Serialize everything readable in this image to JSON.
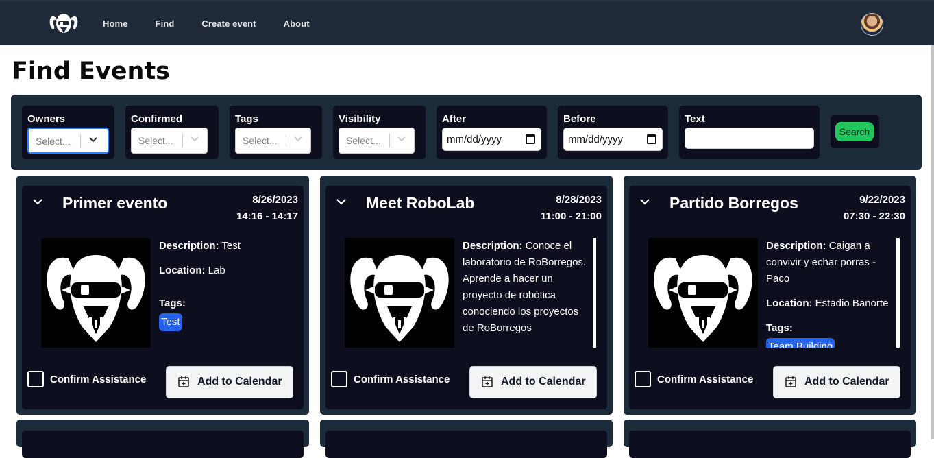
{
  "nav": {
    "logo_icon": "borrego-ram-logo-icon",
    "links": [
      "Home",
      "Find",
      "Create event",
      "About"
    ],
    "avatar_icon": "user-avatar"
  },
  "page": {
    "title": "Find Events"
  },
  "filters": {
    "owners": {
      "label": "Owners",
      "placeholder": "Select..."
    },
    "confirmed": {
      "label": "Confirmed",
      "placeholder": "Select..."
    },
    "tags": {
      "label": "Tags",
      "placeholder": "Select..."
    },
    "visibility": {
      "label": "Visibility",
      "placeholder": "Select..."
    },
    "after": {
      "label": "After",
      "value": "mm/dd/yyyy"
    },
    "before": {
      "label": "Before",
      "value": "mm/dd/yyyy"
    },
    "text": {
      "label": "Text",
      "value": ""
    },
    "search_label": "Search"
  },
  "events": [
    {
      "title": "Primer evento",
      "date": "8/26/2023",
      "time": "14:16 - 14:17",
      "description_label": "Description:",
      "description": "Test",
      "location_label": "Location:",
      "location": "Lab",
      "tags_label": "Tags:",
      "tags": [
        "Test"
      ],
      "confirm_label": "Confirm Assistance",
      "calendar_label": "Add to Calendar"
    },
    {
      "title": "Meet RoboLab",
      "date": "8/28/2023",
      "time": "11:00 - 21:00",
      "description_label": "Description:",
      "description": "Conoce el laboratorio de RoBorregos. Aprende a hacer un proyecto de robótica conociendo los proyectos de RoBorregos",
      "confirm_label": "Confirm Assistance",
      "calendar_label": "Add to Calendar"
    },
    {
      "title": "Partido Borregos",
      "date": "9/22/2023",
      "time": "07:30 - 22:30",
      "description_label": "Description:",
      "description": "Caigan a convivir y echar porras - Paco",
      "location_label": "Location:",
      "location": "Estadio Banorte",
      "tags_label": "Tags:",
      "tags": [
        "Team Building"
      ],
      "confirm_label": "Confirm Assistance",
      "calendar_label": "Add to Calendar"
    }
  ],
  "colors": {
    "nav_bg": "#1f2937",
    "panel_bg": "#1b2b3a",
    "card_bg": "#0e0f1e",
    "search_green": "#22c55e",
    "tag_blue": "#2563eb"
  }
}
